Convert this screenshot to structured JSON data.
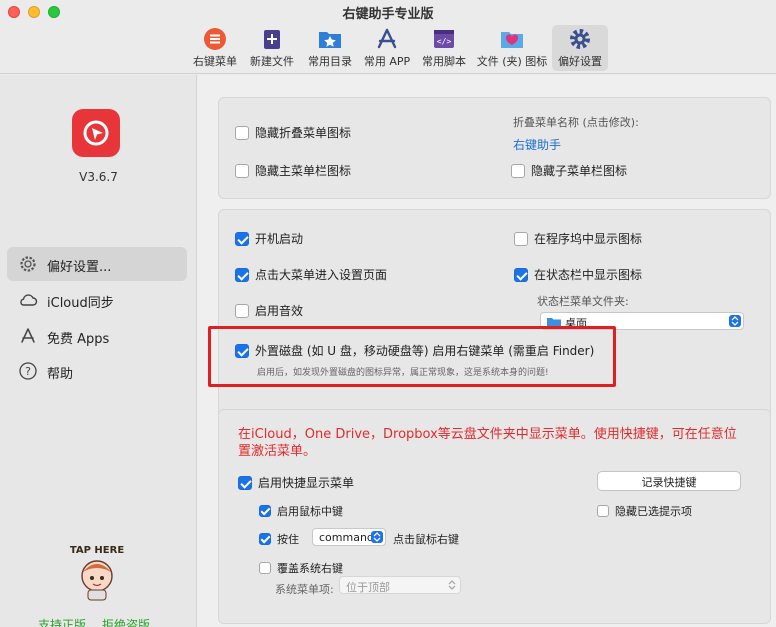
{
  "window": {
    "title": "右键助手专业版"
  },
  "toolbar": {
    "items": [
      {
        "label": "右键菜单",
        "icon": "menu-list-icon"
      },
      {
        "label": "新建文件",
        "icon": "new-file-icon"
      },
      {
        "label": "常用目录",
        "icon": "folder-star-icon"
      },
      {
        "label": "常用 APP",
        "icon": "app-store-icon"
      },
      {
        "label": "常用脚本",
        "icon": "script-icon"
      },
      {
        "label": "文件 (夹) 图标",
        "icon": "folder-heart-icon"
      },
      {
        "label": "偏好设置",
        "icon": "gear-icon",
        "active": true
      }
    ]
  },
  "sidebar": {
    "version": "V3.6.7",
    "items": [
      {
        "label": "偏好设置...",
        "icon": "gear-icon",
        "selected": true
      },
      {
        "label": "iCloud同步",
        "icon": "cloud-icon"
      },
      {
        "label": "免费 Apps",
        "icon": "app-store-icon"
      },
      {
        "label": "帮助",
        "icon": "question-icon"
      }
    ],
    "mascot_text": "TAP HERE",
    "footer": [
      "支持正版",
      "拒绝盗版"
    ]
  },
  "section1": {
    "hide_fold_icon": "隐藏折叠菜单图标",
    "hide_main_icon": "隐藏主菜单栏图标",
    "hide_sub_icon": "隐藏子菜单栏图标",
    "fold_name_label": "折叠菜单名称 (点击修改):",
    "fold_name_value": "右键助手"
  },
  "section2": {
    "launch_at_login": "开机启动",
    "click_menu_settings": "点击大菜单进入设置页面",
    "enable_sound": "启用音效",
    "show_in_dock": "在程序坞中显示图标",
    "show_in_statusbar": "在状态栏中显示图标",
    "statusbar_folder_label": "状态栏菜单文件夹:",
    "statusbar_folder_value": "桌面",
    "external_disk": "外置磁盘 (如 U 盘，移动硬盘等) 启用右键菜单 (需重启 Finder)",
    "external_disk_note": "启用后，如发现外置磁盘的图标异常，属正常现象，这是系统本身的问题!"
  },
  "section3": {
    "cloud_notice": "在iCloud，One Drive，Dropbox等云盘文件夹中显示菜单。使用快捷键，可在任意位置激活菜单。",
    "enable_shortcut": "启用快捷显示菜单",
    "record_shortcut": "记录快捷键",
    "middle_click": "启用鼠标中键",
    "hide_selected": "隐藏已选提示项",
    "press_label": "按住",
    "modifier_value": "command",
    "click_right": "点击鼠标右键",
    "override_system": "覆盖系统右键",
    "system_menu_label": "系统菜单项:",
    "system_menu_value": "位于顶部"
  },
  "colors": {
    "accent": "#1a73e8",
    "highlight": "#e02020",
    "notice": "#e32b2b",
    "brand": "#e8353a"
  }
}
